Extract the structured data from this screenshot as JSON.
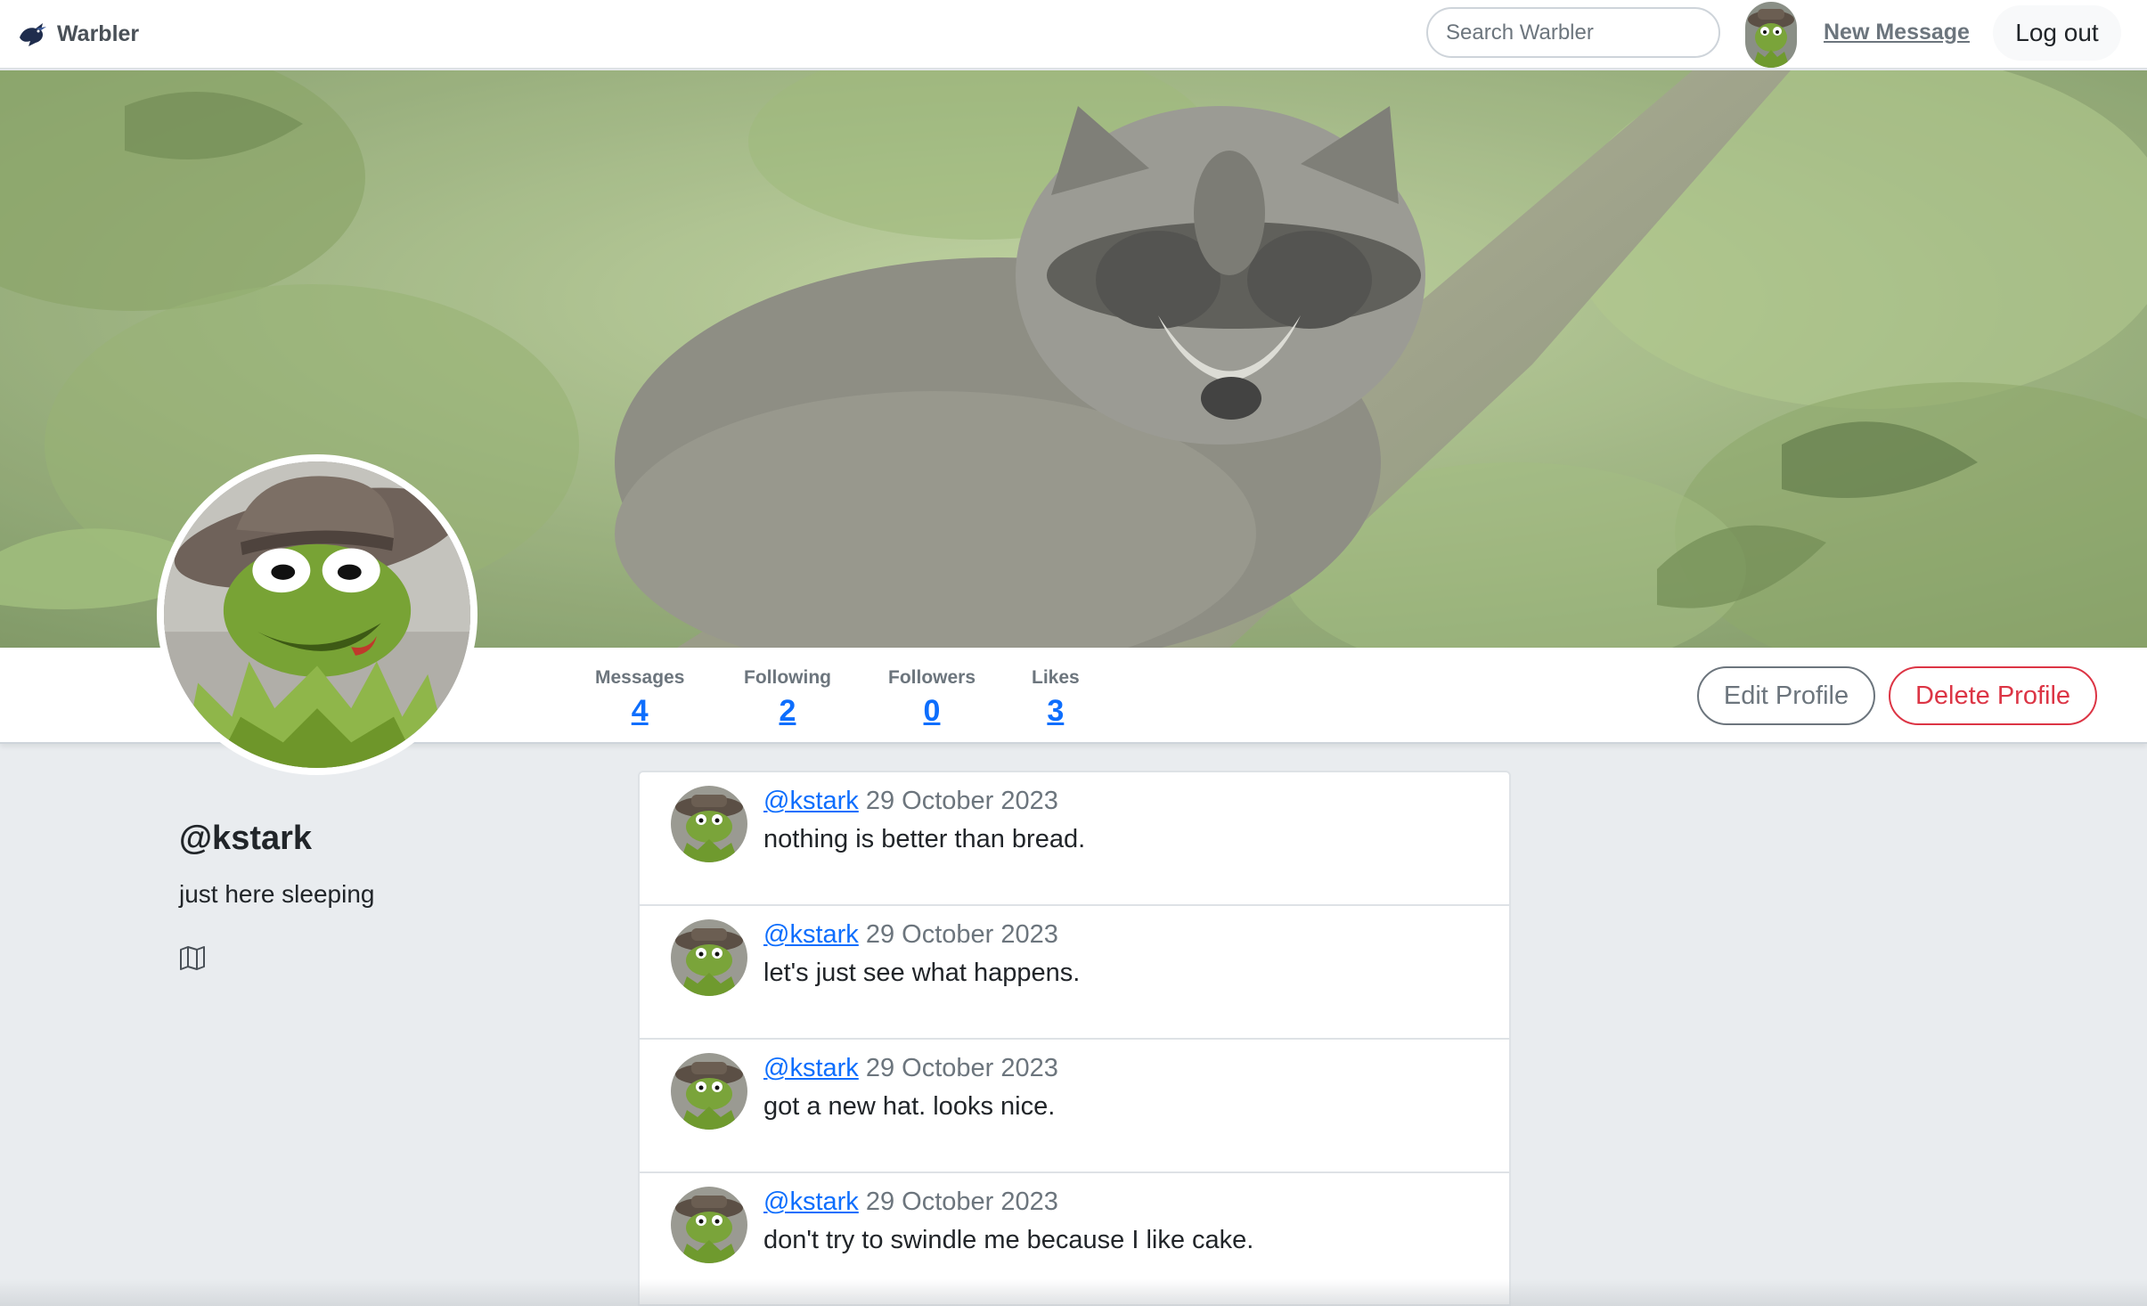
{
  "navbar": {
    "brand": "Warbler",
    "search_placeholder": "Search Warbler",
    "new_message": "New Message",
    "logout": "Log out"
  },
  "profile": {
    "username": "@kstark",
    "bio": "just here sleeping"
  },
  "stats": {
    "messages_label": "Messages",
    "messages_value": "4",
    "following_label": "Following",
    "following_value": "2",
    "followers_label": "Followers",
    "followers_value": "0",
    "likes_label": "Likes",
    "likes_value": "3"
  },
  "actions": {
    "edit": "Edit Profile",
    "delete": "Delete Profile"
  },
  "messages": [
    {
      "user": "@kstark",
      "date": "29 October 2023",
      "text": "nothing is better than bread."
    },
    {
      "user": "@kstark",
      "date": "29 October 2023",
      "text": "let's just see what happens."
    },
    {
      "user": "@kstark",
      "date": "29 October 2023",
      "text": "got a new hat. looks nice."
    },
    {
      "user": "@kstark",
      "date": "29 October 2023",
      "text": "don't try to swindle me because I like cake."
    }
  ],
  "icons": [
    "warbler-bird-icon",
    "search-icon",
    "map-icon"
  ],
  "colors": {
    "link": "#0d6efd",
    "danger": "#dc3545",
    "secondary": "#6c757d",
    "page_bg": "#e9ecef"
  }
}
